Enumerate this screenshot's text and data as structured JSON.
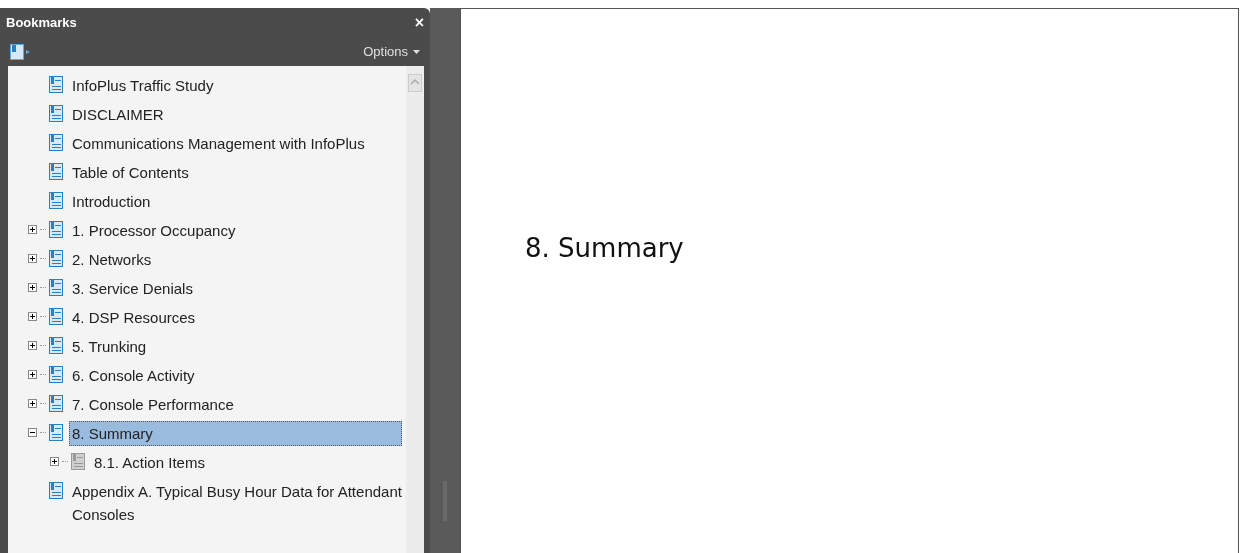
{
  "panel": {
    "title": "Bookmarks",
    "close": "×",
    "options": "Options"
  },
  "bookmarks": [
    {
      "label": "InfoPlus Traffic Study",
      "kind": "leaf",
      "greyed": false,
      "selected": false
    },
    {
      "label": "DISCLAIMER",
      "kind": "leaf",
      "greyed": false,
      "selected": false
    },
    {
      "label": "Communications Management with InfoPlus",
      "kind": "leaf",
      "greyed": false,
      "selected": false
    },
    {
      "label": "Table of Contents",
      "kind": "leaf",
      "greyed": false,
      "selected": false
    },
    {
      "label": "Introduction",
      "kind": "leaf",
      "greyed": false,
      "selected": false
    },
    {
      "label": "1. Processor Occupancy",
      "kind": "branch",
      "expanded": false,
      "greyed": false,
      "selected": false
    },
    {
      "label": "2. Networks",
      "kind": "branch",
      "expanded": false,
      "greyed": false,
      "selected": false
    },
    {
      "label": "3. Service Denials",
      "kind": "branch",
      "expanded": false,
      "greyed": false,
      "selected": false
    },
    {
      "label": "4. DSP Resources",
      "kind": "branch",
      "expanded": false,
      "greyed": false,
      "selected": false
    },
    {
      "label": "5. Trunking",
      "kind": "branch",
      "expanded": false,
      "greyed": false,
      "selected": false
    },
    {
      "label": "6. Console Activity",
      "kind": "branch",
      "expanded": false,
      "greyed": false,
      "selected": false
    },
    {
      "label": "7. Console Performance",
      "kind": "branch",
      "expanded": false,
      "greyed": false,
      "selected": false
    },
    {
      "label": "8. Summary",
      "kind": "branch",
      "expanded": true,
      "greyed": false,
      "selected": true,
      "children": [
        {
          "label": "8.1. Action Items",
          "kind": "branch",
          "expanded": false,
          "greyed": true,
          "selected": false
        }
      ]
    },
    {
      "label": "Appendix A. Typical Busy Hour Data for Attendant Consoles",
      "kind": "leaf",
      "greyed": false,
      "selected": false
    }
  ],
  "document": {
    "heading": "8. Summary"
  }
}
